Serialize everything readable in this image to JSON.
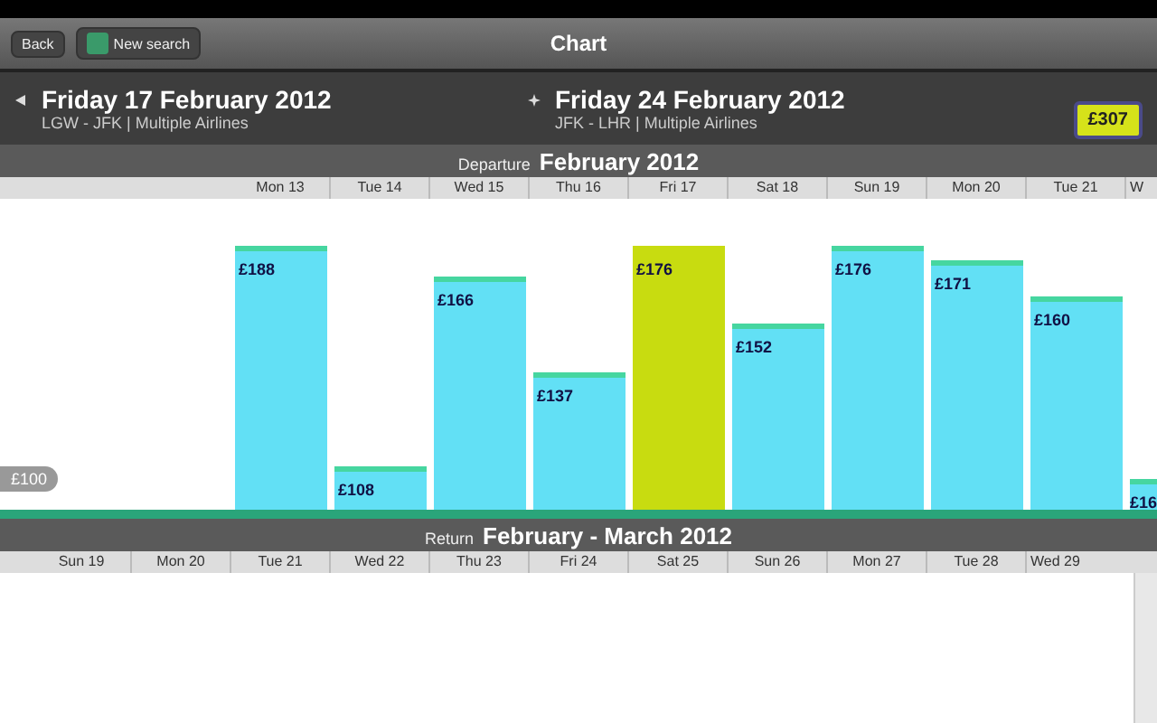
{
  "nav": {
    "back": "Back",
    "new_search": "New search",
    "title": "Chart"
  },
  "outbound": {
    "date": "Friday 17 February 2012",
    "route": "LGW - JFK | Multiple Airlines"
  },
  "inbound": {
    "date": "Friday 24 February 2012",
    "route": "JFK - LHR | Multiple Airlines"
  },
  "total": {
    "price": "£307"
  },
  "departure": {
    "label": "Departure",
    "month": "February 2012",
    "scale_label": "£100",
    "days": [
      {
        "label": "Mon 13",
        "price": "£188",
        "selected": false
      },
      {
        "label": "Tue 14",
        "price": "£108",
        "selected": false
      },
      {
        "label": "Wed 15",
        "price": "£166",
        "selected": false
      },
      {
        "label": "Thu 16",
        "price": "£137",
        "selected": false
      },
      {
        "label": "Fri 17",
        "price": "£176",
        "selected": true
      },
      {
        "label": "Sat 18",
        "price": "£152",
        "selected": false
      },
      {
        "label": "Sun 19",
        "price": "£176",
        "selected": false
      },
      {
        "label": "Mon 20",
        "price": "£171",
        "selected": false
      },
      {
        "label": "Tue 21",
        "price": "£160",
        "selected": false
      },
      {
        "label": "W",
        "price": "£16",
        "selected": false
      }
    ]
  },
  "return": {
    "label": "Return",
    "month": "February - March 2012",
    "days": [
      "Sun 19",
      "Mon 20",
      "Tue 21",
      "Wed 22",
      "Thu 23",
      "Fri 24",
      "Sat 25",
      "Sun 26",
      "Mon 27",
      "Tue 28",
      "Wed 29"
    ]
  }
}
